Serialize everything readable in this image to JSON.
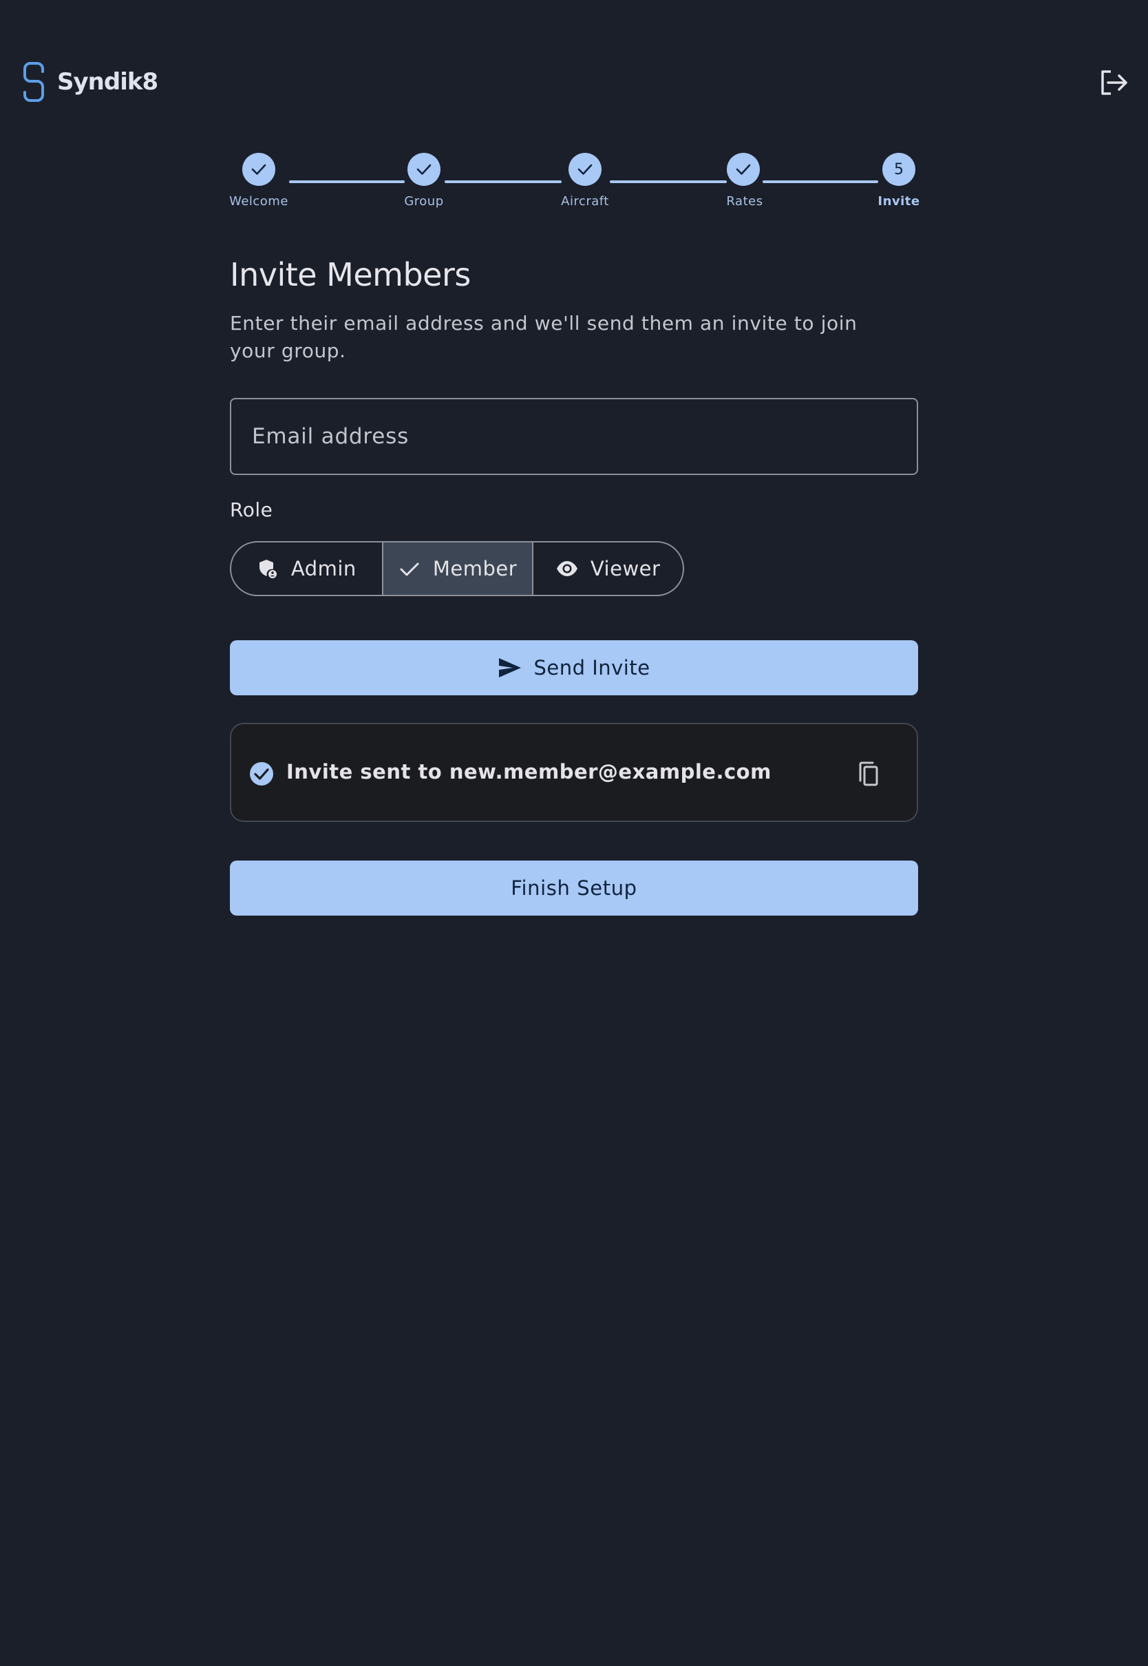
{
  "brand": {
    "name": "Syndik8",
    "logo_icon": "syndik8-logo-icon",
    "accent": "#a8c8f5",
    "background": "#1b1f2a"
  },
  "header": {
    "logout_icon": "logout-icon"
  },
  "stepper": {
    "steps": [
      {
        "label": "Welcome",
        "status": "complete"
      },
      {
        "label": "Group",
        "status": "complete"
      },
      {
        "label": "Aircraft",
        "status": "complete"
      },
      {
        "label": "Rates",
        "status": "complete"
      },
      {
        "label": "Invite",
        "status": "active",
        "number": "5"
      }
    ]
  },
  "invite": {
    "title": "Invite Members",
    "subtitle": "Enter their email address and we'll send them an invite to join your group.",
    "email_placeholder": "Email address",
    "email_value": "",
    "role_label": "Role",
    "roles": [
      {
        "label": "Admin",
        "icon": "admin-shield-icon",
        "selected": false
      },
      {
        "label": "Member",
        "icon": "check-icon",
        "selected": true
      },
      {
        "label": "Viewer",
        "icon": "eye-icon",
        "selected": false
      }
    ],
    "send_label": "Send Invite",
    "send_icon": "send-icon"
  },
  "notice": {
    "text": "Invite sent to new.member@example.com",
    "status_icon": "check-circle-icon",
    "copy_icon": "copy-icon"
  },
  "finish_label": "Finish Setup"
}
